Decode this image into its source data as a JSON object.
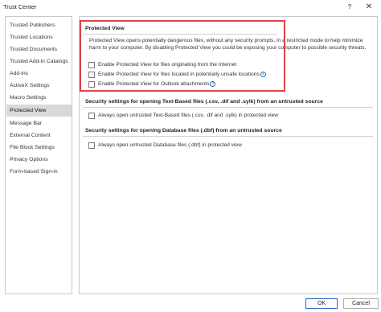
{
  "window": {
    "title": "Trust Center",
    "help_label": "?",
    "close_label": "✕"
  },
  "sidebar": {
    "items": [
      {
        "label": "Trusted Publishers",
        "selected": false
      },
      {
        "label": "Trusted Locations",
        "selected": false
      },
      {
        "label": "Trusted Documents",
        "selected": false
      },
      {
        "label": "Trusted Add-in Catalogs",
        "selected": false
      },
      {
        "label": "Add-ins",
        "selected": false
      },
      {
        "label": "ActiveX Settings",
        "selected": false
      },
      {
        "label": "Macro Settings",
        "selected": false
      },
      {
        "label": "Protected View",
        "selected": true
      },
      {
        "label": "Message Bar",
        "selected": false
      },
      {
        "label": "External Content",
        "selected": false
      },
      {
        "label": "File Block Settings",
        "selected": false
      },
      {
        "label": "Privacy Options",
        "selected": false
      },
      {
        "label": "Form-based Sign-in",
        "selected": false
      }
    ]
  },
  "protected_view": {
    "header": "Protected View",
    "description": "Protected View opens potentially dangerous files, without any security prompts, in a restricted mode to help minimize harm to your computer. By disabling Protected View you could be exposing your computer to possible security threats.",
    "options": [
      {
        "label": "Enable Protected View for files originating from the Internet",
        "checked": false,
        "info": false
      },
      {
        "label": "Enable Protected View for files located in potentially unsafe locations",
        "checked": false,
        "info": true
      },
      {
        "label": "Enable Protected View for Outlook attachments",
        "checked": false,
        "info": true
      }
    ]
  },
  "text_based": {
    "header": "Security settings for opening Text-Based files (.csv, .dif and .sylk) from an untrusted source",
    "option": {
      "label": "Always open untrusted Text-Based files (.csv, .dif and .sylk) in protected view",
      "checked": false
    }
  },
  "database": {
    "header": "Security settings for opening Database files (.dbf) from an untrusted source",
    "option": {
      "label": "Always open untrusted Database files (.dbf) in protected view",
      "checked": false
    }
  },
  "info_icon_glyph": "i",
  "footer": {
    "ok_label": "OK",
    "cancel_label": "Cancel"
  },
  "colors": {
    "highlight": "#e0414a",
    "selected_bg": "#d9d9d9",
    "accent": "#2b67c5"
  }
}
